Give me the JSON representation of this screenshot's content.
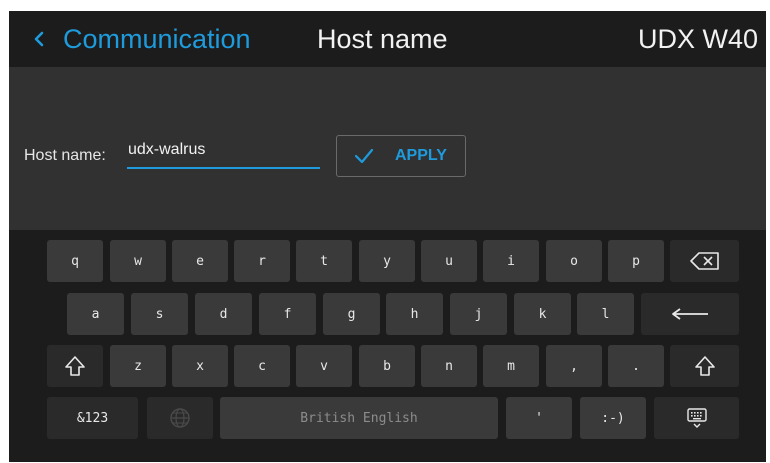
{
  "header": {
    "back_label": "Communication",
    "title": "Host name",
    "device": "UDX W40",
    "back_icon": "chevron-left-icon"
  },
  "form": {
    "host_label": "Host name:",
    "host_value": "udx-walrus",
    "apply_label": "APPLY",
    "apply_icon": "check-icon"
  },
  "keyboard": {
    "row1": [
      "q",
      "w",
      "e",
      "r",
      "t",
      "y",
      "u",
      "i",
      "o",
      "p"
    ],
    "row2": [
      "a",
      "s",
      "d",
      "f",
      "g",
      "h",
      "j",
      "k",
      "l"
    ],
    "row3": [
      "z",
      "x",
      "c",
      "v",
      "b",
      "n",
      "m",
      ",",
      "."
    ],
    "symbols_label": "&123",
    "space_label": "British English",
    "apostrophe_label": "'",
    "smiley_label": ":-)",
    "icons": {
      "backspace": "backspace-icon",
      "enter": "enter-icon",
      "shift": "shift-icon",
      "language": "globe-icon",
      "hide": "keyboard-hide-icon"
    }
  },
  "colors": {
    "accent": "#1e9bdc",
    "background": "#313131",
    "header_background": "#1c1c1c",
    "key": "#3a3a3a",
    "function_key": "#2a2a2a",
    "text": "#f2f2f2"
  }
}
